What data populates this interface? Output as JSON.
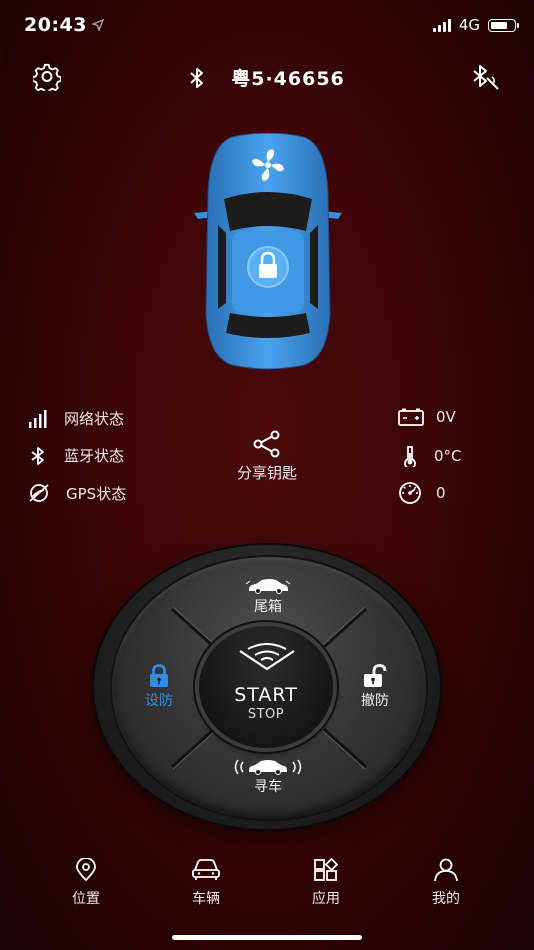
{
  "status_bar": {
    "time": "20:43",
    "network": "4G"
  },
  "header": {
    "plate": "粤5·46656"
  },
  "status": {
    "network_label": "网络状态",
    "bluetooth_label": "蓝牙状态",
    "gps_label": "GPS状态",
    "share_label": "分享钥匙",
    "voltage": "0V",
    "temperature": "0°C",
    "speed": "0"
  },
  "control": {
    "trunk_label": "尾箱",
    "arm_label": "设防",
    "disarm_label": "撤防",
    "find_label": "寻车",
    "start_label": "START",
    "stop_label": "STOP"
  },
  "nav": [
    {
      "label": "位置",
      "icon": "location-icon"
    },
    {
      "label": "车辆",
      "icon": "car-icon"
    },
    {
      "label": "应用",
      "icon": "apps-icon"
    },
    {
      "label": "我的",
      "icon": "user-icon"
    }
  ],
  "colors": {
    "accent": "#2f8fe8",
    "car_body": "#3a8fd9",
    "background": "#3a0608"
  }
}
